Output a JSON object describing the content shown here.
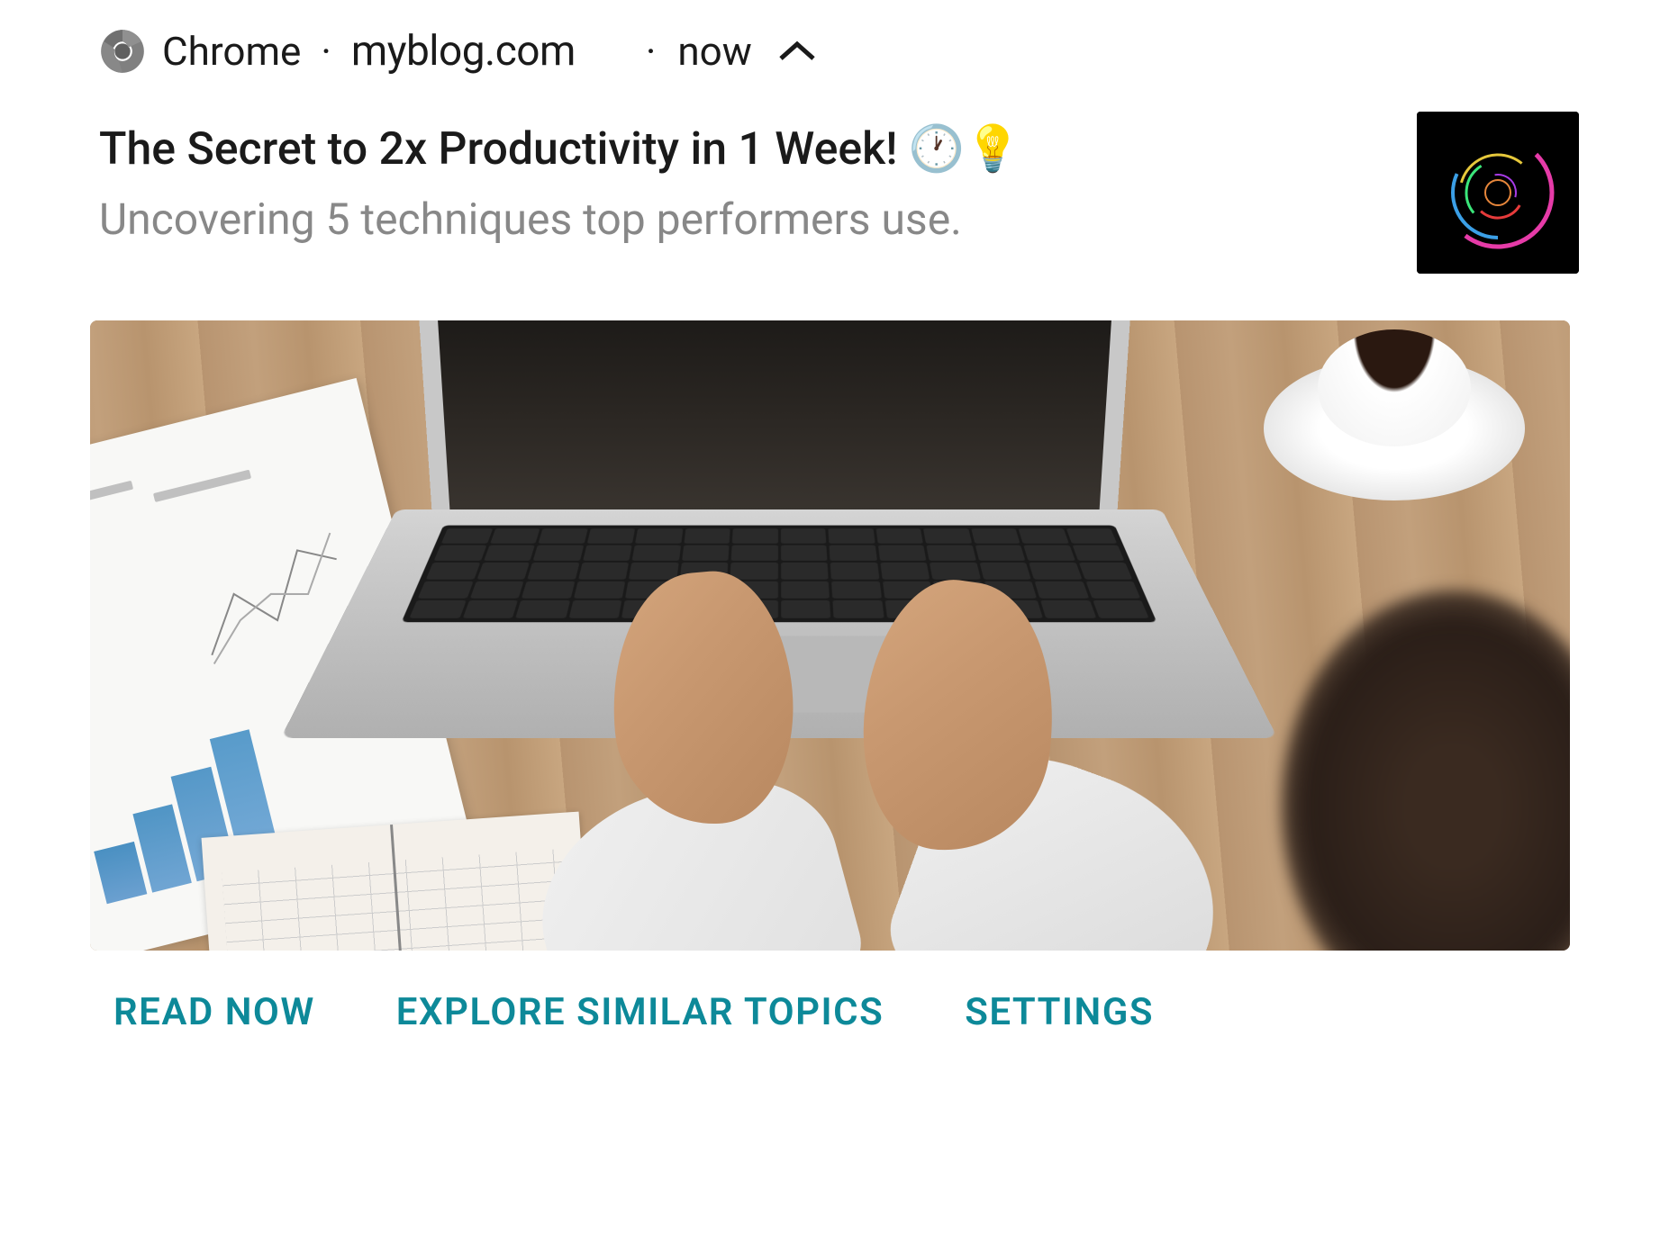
{
  "header": {
    "app_name": "Chrome",
    "domain": "myblog.com",
    "timestamp": "now",
    "separator": "·"
  },
  "notification": {
    "title": "The Secret to 2x Productivity in 1 Week! 🕐💡",
    "body": "Uncovering 5 techniques top performers use."
  },
  "actions": {
    "read_now": "READ NOW",
    "explore": "EXPLORE SIMILAR TOPICS",
    "settings": "SETTINGS"
  },
  "colors": {
    "action_color": "#0d8999",
    "text_primary": "#1a1a1a",
    "text_secondary": "#888888"
  }
}
